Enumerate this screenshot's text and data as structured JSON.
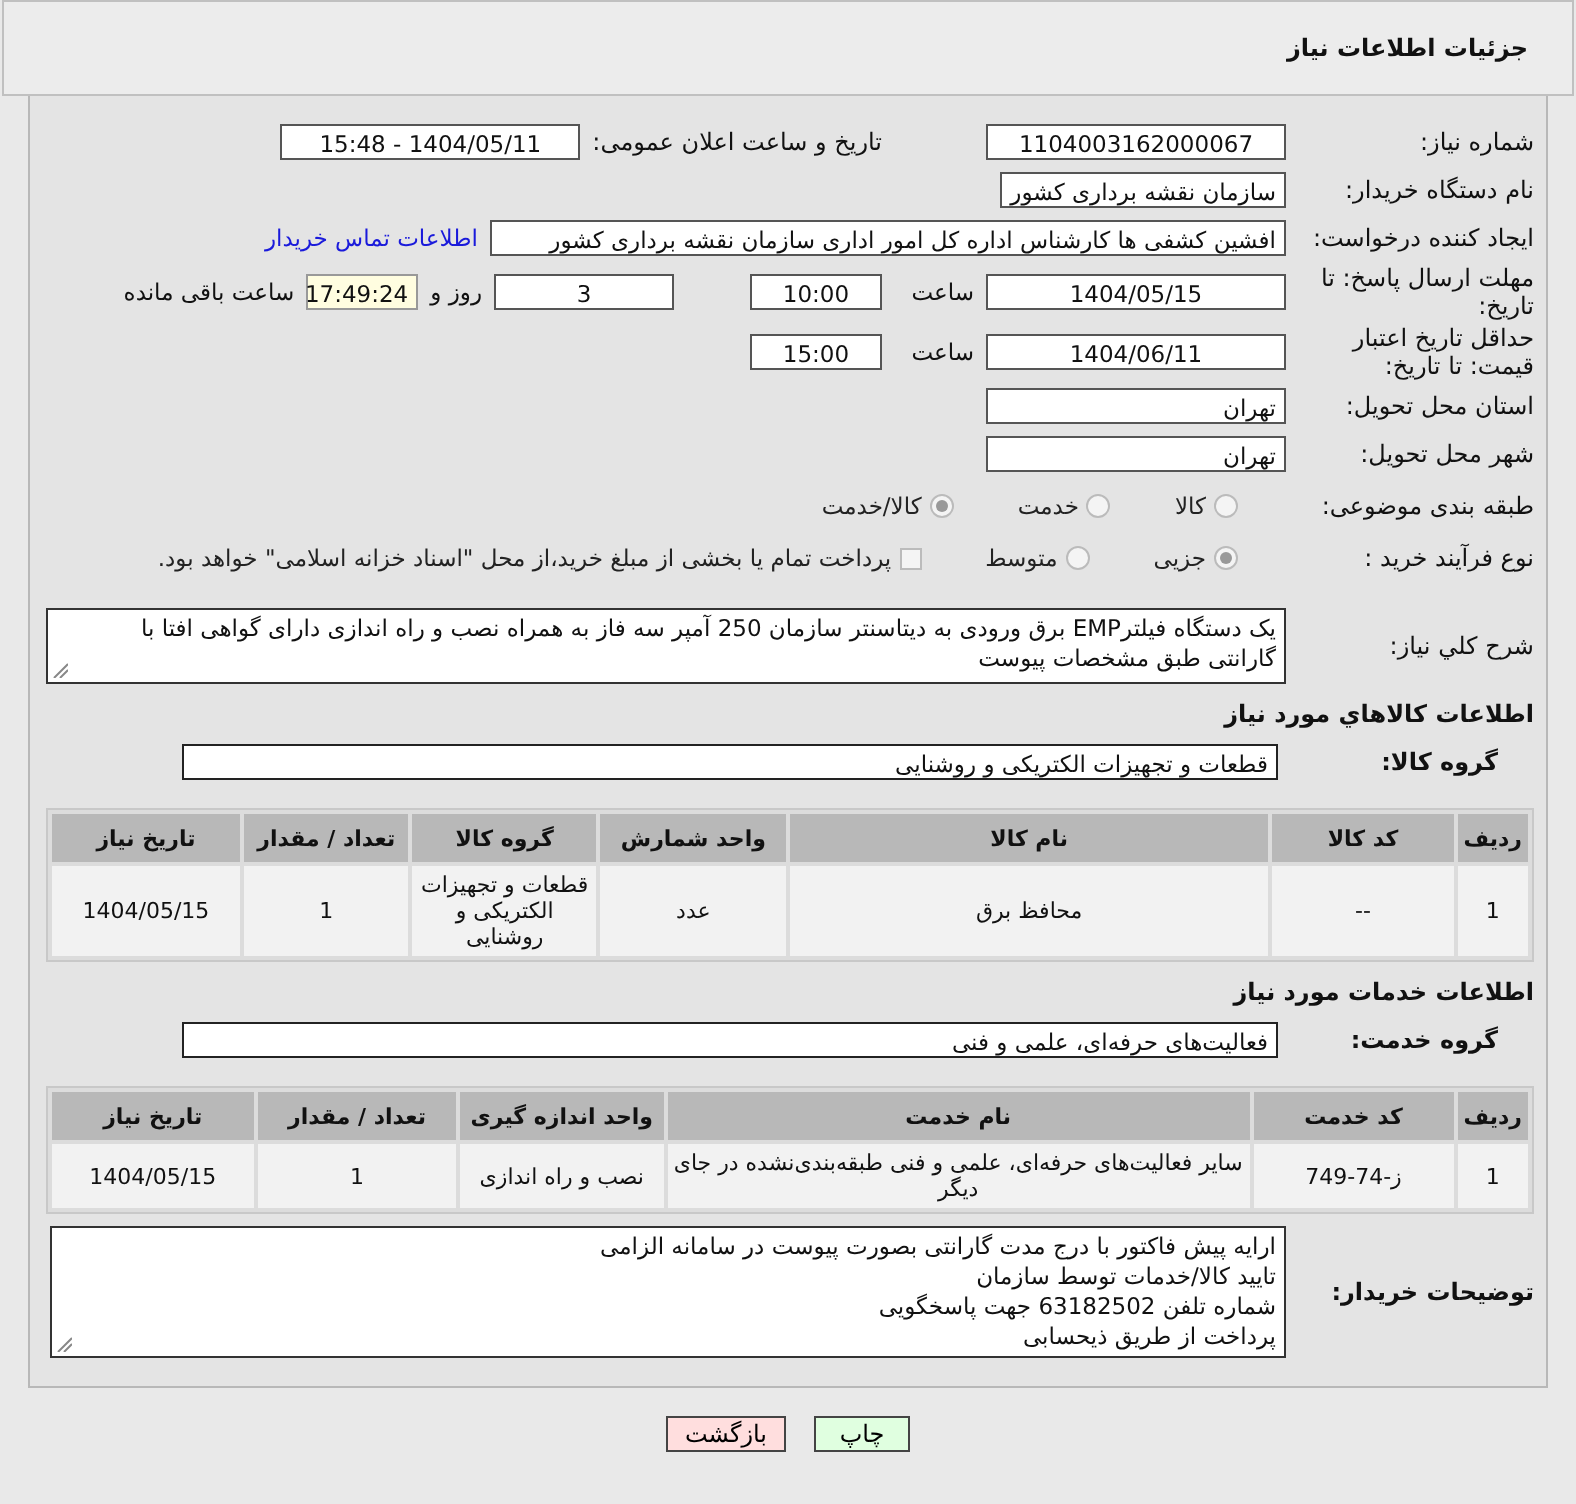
{
  "header": {
    "title": "جزئیات اطلاعات نیاز"
  },
  "need_number": {
    "label": "شماره نیاز:",
    "value": "1104003162000067"
  },
  "announce": {
    "label": "تاریخ و ساعت اعلان عمومی:",
    "value": "1404/05/11 - 15:48"
  },
  "buyer_org": {
    "label": "نام دستگاه خریدار:",
    "value": "سازمان نقشه برداری کشور"
  },
  "requester": {
    "label": "ایجاد کننده درخواست:",
    "value": "افشین کشفی ها کارشناس اداره کل امور اداری سازمان نقشه برداری کشور",
    "link": "اطلاعات تماس خریدار"
  },
  "reply_deadline": {
    "label": "مهلت ارسال پاسخ: تا تاریخ:",
    "date": "1404/05/15",
    "time_label": "ساعت",
    "time": "10:00",
    "days": "3",
    "days_label": "روز و",
    "remaining": "17:49:24",
    "remaining_label": "ساعت باقی مانده"
  },
  "price_validity": {
    "label": "حداقل تاریخ اعتبار قیمت: تا تاریخ:",
    "date": "1404/06/11",
    "time_label": "ساعت",
    "time": "15:00"
  },
  "province": {
    "label": "استان محل تحویل:",
    "value": "تهران"
  },
  "city": {
    "label": "شهر محل تحویل:",
    "value": "تهران"
  },
  "category": {
    "label": "طبقه بندی موضوعی:",
    "options": [
      {
        "label": "کالا",
        "selected": false
      },
      {
        "label": "خدمت",
        "selected": false
      },
      {
        "label": "کالا/خدمت",
        "selected": true
      }
    ]
  },
  "process": {
    "label": "نوع فرآیند خرید :",
    "options": [
      {
        "label": "جزیی",
        "selected": true
      },
      {
        "label": "متوسط",
        "selected": false
      }
    ],
    "payment": {
      "label": "پرداخت تمام یا بخشی از مبلغ خرید،از محل \"اسناد خزانه اسلامی\" خواهد بود.",
      "checked": false
    }
  },
  "description": {
    "label": "شرح کلي نياز:",
    "value": "یک دستگاه فیلترEMP  برق ورودی به دیتاسنتر سازمان 250 آمپر سه فاز به همراه نصب و راه اندازی دارای گواهی افتا با گارانتی طبق مشخصات پیوست"
  },
  "goods": {
    "title": "اطلاعات کالاهاي مورد نياز",
    "group_label": "گروه کالا:",
    "group_value": "قطعات و تجهیزات الکتریکی و روشنایی",
    "columns": [
      "ردیف",
      "کد کالا",
      "نام کالا",
      "واحد شمارش",
      "گروه کالا",
      "تعداد / مقدار",
      "تاریخ نیاز"
    ],
    "rows": [
      [
        "1",
        "--",
        "محافظ برق",
        "عدد",
        "قطعات و تجهیزات الکتریکی و روشنایی",
        "1",
        "1404/05/15"
      ]
    ]
  },
  "services": {
    "title": "اطلاعات خدمات مورد نیاز",
    "group_label": "گروه خدمت:",
    "group_value": "فعالیت‌های حرفه‌ای، علمی و فنی",
    "columns": [
      "ردیف",
      "کد خدمت",
      "نام خدمت",
      "واحد اندازه گیری",
      "تعداد / مقدار",
      "تاریخ نیاز"
    ],
    "rows": [
      [
        "1",
        "ز-74-749",
        "سایر فعالیت‌های حرفه‌ای، علمی و فنی طبقه‌بندی‌نشده در جای دیگر",
        "نصب و راه اندازی",
        "1",
        "1404/05/15"
      ]
    ]
  },
  "buyer_notes": {
    "label": "توضیحات خریدار:",
    "lines": [
      "ارایه پیش فاکتور با درج مدت گارانتی بصورت پیوست در سامانه الزامی",
      "تایید کالا/خدمات  توسط سازمان",
      "شماره تلفن 63182502 جهت پاسخگویی",
      "پرداخت از طریق ذیحسابی"
    ]
  },
  "buttons": [
    {
      "label": "چاپ",
      "kind": "print"
    },
    {
      "label": "بازگشت",
      "kind": "back"
    }
  ]
}
